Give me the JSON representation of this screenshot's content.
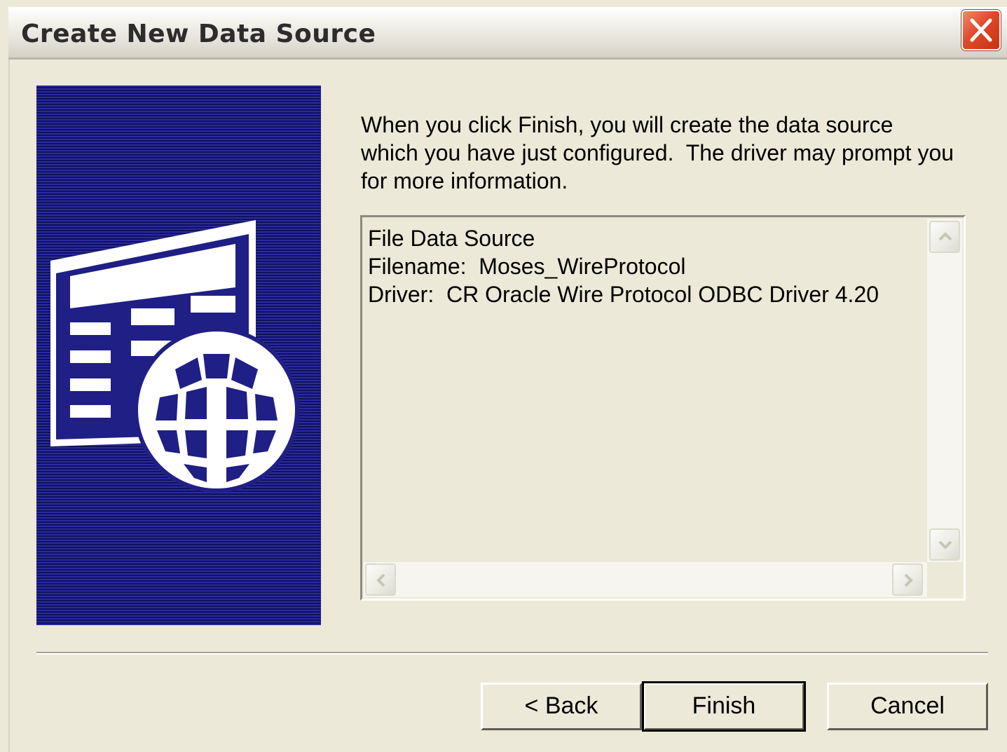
{
  "window": {
    "title": "Create New Data Source"
  },
  "icons": {
    "close": "close-icon",
    "graphic": "data-source-globe-icon",
    "scroll_up": "scroll-up-arrow-icon",
    "scroll_down": "scroll-down-arrow-icon",
    "scroll_left": "scroll-left-arrow-icon",
    "scroll_right": "scroll-right-arrow-icon"
  },
  "main": {
    "description": "When you click Finish, you will create the data source\nwhich you have just configured.  The driver may prompt you\nfor more information.",
    "summary": {
      "lines": [
        "File Data Source",
        "Filename:  Moses_WireProtocol",
        "Driver:  CR Oracle Wire Protocol ODBC Driver 4.20"
      ]
    }
  },
  "buttons": {
    "back_label": "< Back",
    "finish_label": "Finish",
    "cancel_label": "Cancel"
  },
  "colors": {
    "dialog_bg": "#ece9d8",
    "graphic_bg": "#1f1f86",
    "close_red": "#e0492a"
  }
}
